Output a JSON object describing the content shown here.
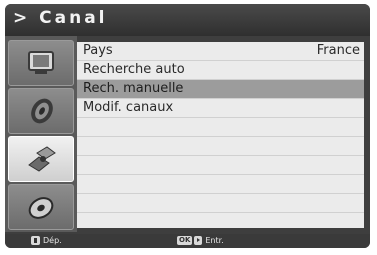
{
  "header": {
    "title": "> Canal"
  },
  "sidebar": {
    "items": [
      {
        "icon": "tv-icon",
        "active": false
      },
      {
        "icon": "speaker-icon",
        "active": false
      },
      {
        "icon": "satellite-icon",
        "active": true
      },
      {
        "icon": "disc-icon",
        "active": false
      }
    ]
  },
  "menu": {
    "rows": [
      {
        "label": "Pays",
        "value": "France"
      },
      {
        "label": "Recherche auto",
        "value": ""
      },
      {
        "label": "Rech. manuelle",
        "value": "",
        "selected": true
      },
      {
        "label": "Modif. canaux",
        "value": ""
      }
    ]
  },
  "footer": {
    "nav_label": "Dép.",
    "ok_key": "OK",
    "enter_label": "Entr."
  }
}
